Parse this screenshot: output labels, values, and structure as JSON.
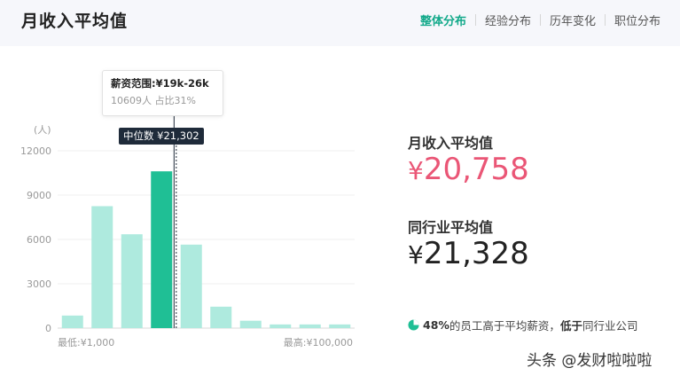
{
  "header": {
    "title": "月收入平均值",
    "tabs": [
      {
        "label": "整体分布",
        "active": true
      },
      {
        "label": "经验分布",
        "active": false
      },
      {
        "label": "历年变化",
        "active": false
      },
      {
        "label": "职位分布",
        "active": false
      }
    ]
  },
  "chart_data": {
    "type": "bar",
    "ylabel": "(人)",
    "yticks": [
      "0",
      "3000",
      "6000",
      "9000",
      "12000"
    ],
    "ylim": [
      0,
      12000
    ],
    "values": [
      850,
      8250,
      6350,
      10609,
      5650,
      1450,
      500,
      250,
      250,
      250
    ],
    "highlight_index": 3,
    "x_min_label": "最低:¥1,000",
    "x_max_label": "最高:¥100,000",
    "bar_color": "#aeeade",
    "highlight_color": "#1fbf95",
    "median_fraction": 0.395
  },
  "tooltip": {
    "range": "薪资范围:¥19k-26k",
    "count": "10609人  占比31%"
  },
  "median": {
    "label": "中位数 ¥21,302"
  },
  "stats": {
    "avg_label": "月收入平均值",
    "avg_currency": "¥",
    "avg_value": "20,758",
    "industry_label": "同行业平均值",
    "industry_currency": "¥",
    "industry_value": "21,328"
  },
  "comparison": {
    "percent": "48%",
    "text1": "的员工高于平均薪资，",
    "emph": "低于",
    "text2": "同行业公司",
    "icon": "pie-chart-icon",
    "icon_color": "#1fbf95"
  },
  "watermark": "头条 @发财啦啦啦"
}
